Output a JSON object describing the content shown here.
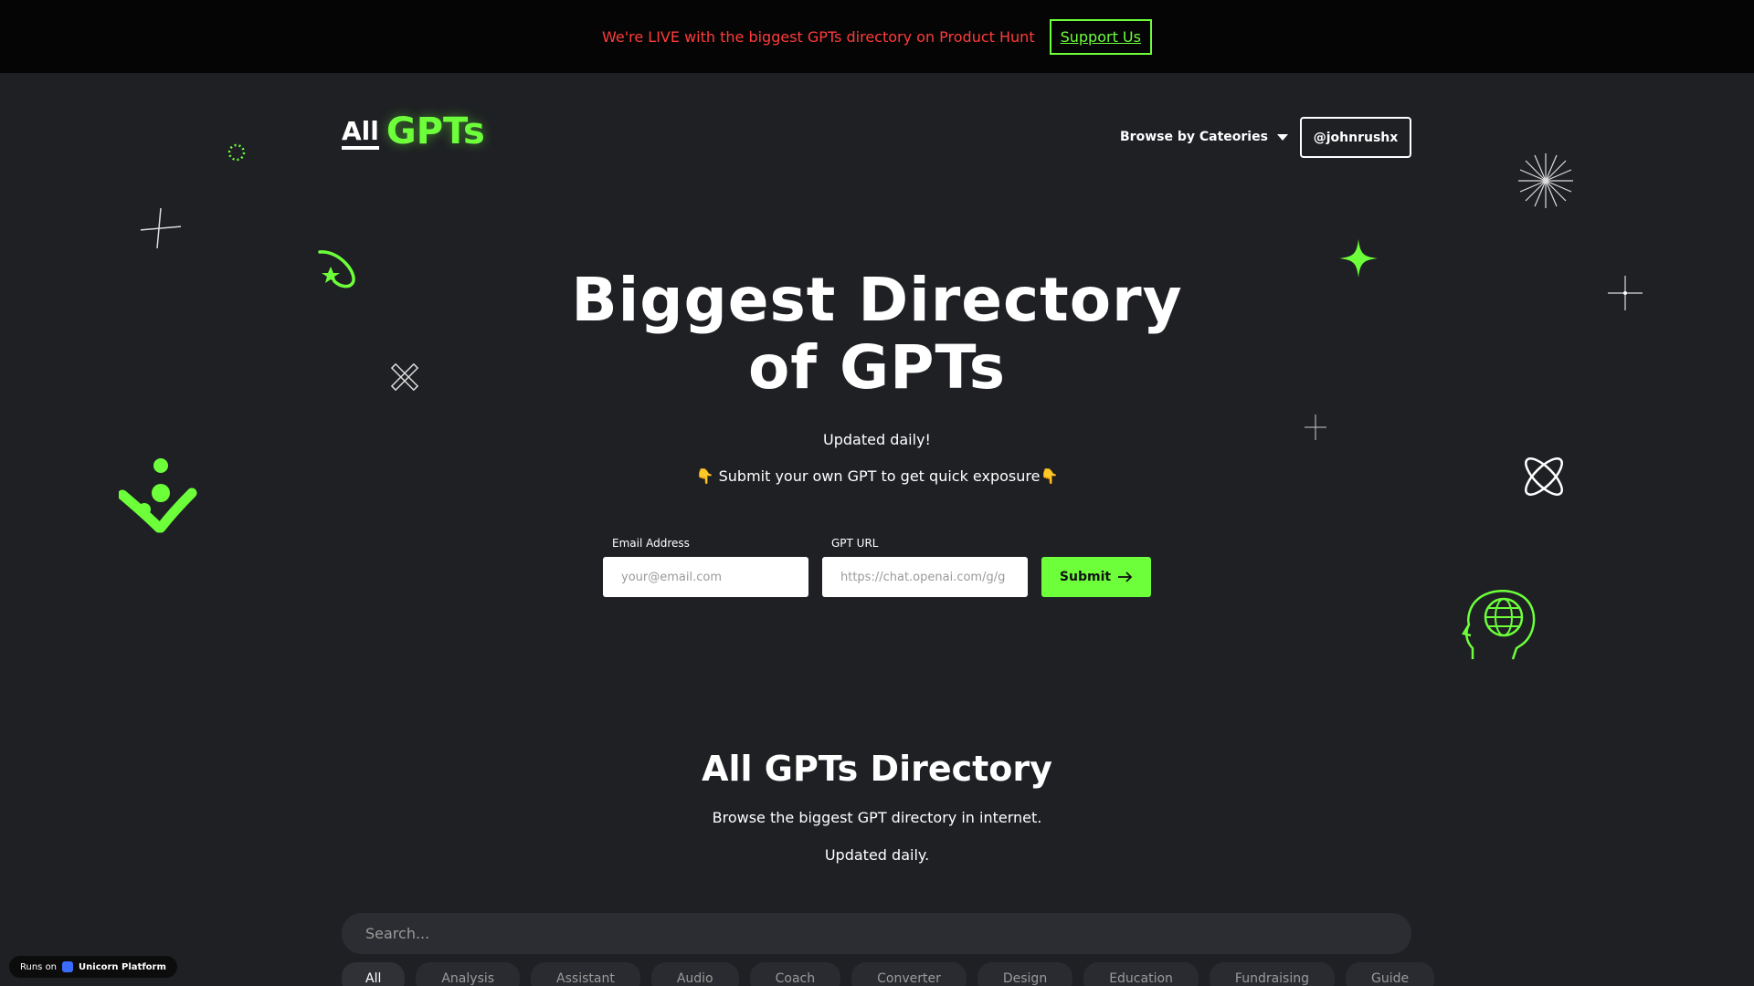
{
  "announcement": {
    "text": "We're LIVE with the biggest GPTs directory on Product Hunt",
    "button_label": "Support Us"
  },
  "header": {
    "logo_prefix": "All",
    "logo_main": "GPTs",
    "browse_label": "Browse by Cateories",
    "user_label": "@johnrushx"
  },
  "hero": {
    "title_line1": "Biggest Directory",
    "title_line2": "of GPTs",
    "subtitle": "Updated daily!",
    "submit_prompt": "👇 Submit your own GPT to get quick exposure👇"
  },
  "form": {
    "email_label": "Email Address",
    "email_placeholder": "your@email.com",
    "url_label": "GPT URL",
    "url_placeholder": "https://chat.openai.com/g/g",
    "submit_label": "Submit"
  },
  "directory": {
    "title": "All GPTs Directory",
    "subtitle": "Browse the biggest GPT directory in internet.",
    "updated": "Updated daily.",
    "search_placeholder": "Search...",
    "categories": [
      "All",
      "Analysis",
      "Assistant",
      "Audio",
      "Coach",
      "Converter",
      "Design",
      "Education",
      "Fundraising",
      "Guide"
    ]
  },
  "badge": {
    "prefix": "Runs on",
    "name": "Unicorn Platform"
  },
  "colors": {
    "accent": "#6cff3a",
    "announcement_text": "#ff3b3b",
    "background": "#1f2024",
    "topbar": "#050505"
  },
  "icons": [
    "sparkle-icon",
    "dotted-circle-icon",
    "orbit-star-icon",
    "cross-x-icon",
    "molecule-icon",
    "four-point-star-icon",
    "starburst-icon",
    "atom-icon",
    "head-globe-icon",
    "plus-sparkle-icon",
    "arrow-right-icon",
    "caret-down-icon"
  ]
}
